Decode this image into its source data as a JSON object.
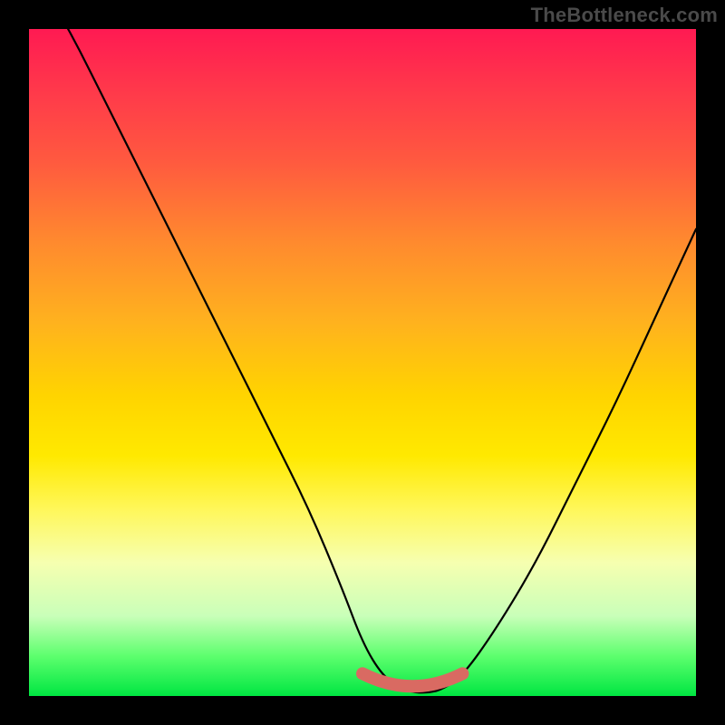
{
  "watermark": "TheBottleneck.com",
  "chart_data": {
    "type": "line",
    "title": "",
    "xlabel": "",
    "ylabel": "",
    "xlim": [
      0,
      100
    ],
    "ylim": [
      0,
      100
    ],
    "series": [
      {
        "name": "bottleneck-curve",
        "x": [
          0,
          6,
          12,
          18,
          24,
          30,
          36,
          42,
          47,
          50,
          53,
          56,
          58,
          60,
          62,
          65,
          70,
          76,
          82,
          88,
          94,
          100
        ],
        "values": [
          110,
          100,
          88,
          76,
          64,
          52,
          40,
          28,
          16,
          8,
          3,
          1,
          0.5,
          0.5,
          1,
          3,
          10,
          20,
          32,
          44,
          57,
          70
        ]
      }
    ],
    "highlight": {
      "name": "optimal-band",
      "color": "#d96a62",
      "x_range": [
        50,
        65
      ],
      "y": 2
    }
  }
}
